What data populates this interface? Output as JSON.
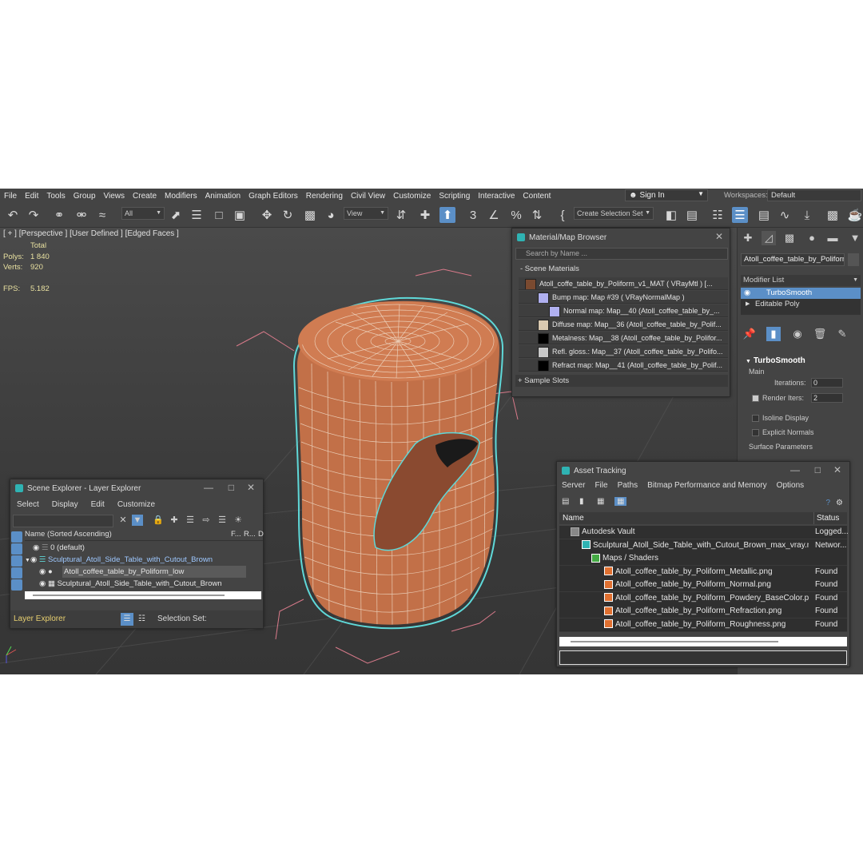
{
  "menu": [
    "File",
    "Edit",
    "Tools",
    "Group",
    "Views",
    "Create",
    "Modifiers",
    "Animation",
    "Graph Editors",
    "Rendering",
    "Civil View",
    "Customize",
    "Scripting",
    "Interactive",
    "Content"
  ],
  "signin": {
    "label": "Sign In"
  },
  "workspaces": {
    "label": "Workspaces:",
    "value": "Default"
  },
  "toolbar": {
    "filter": "All",
    "ref_coord": "View",
    "selection_set": "Create Selection Set"
  },
  "viewport": {
    "label": "[ + ] [Perspective ] [User Defined ] [Edged Faces ]",
    "stats_total": "Total",
    "polys_label": "Polys:",
    "polys": "1 840",
    "verts_label": "Verts:",
    "verts": "920",
    "fps_label": "FPS:",
    "fps": "5.182"
  },
  "material_browser": {
    "title": "Material/Map Browser",
    "search_placeholder": "Search by Name ...",
    "section": "- Scene Materials",
    "rows": [
      {
        "label": "Atoll_coffe_table_by_Poliform_v1_MAT  ( VRayMtl )  [...",
        "color": "#7a4a30"
      },
      {
        "label": "Bump map: Map #39  ( VRayNormalMap )",
        "color": "#b0b0f0"
      },
      {
        "label": "Normal map: Map__40 (Atoll_coffee_table_by_...",
        "color": "#b0b0f0"
      },
      {
        "label": "Diffuse map: Map__36 (Atoll_coffee_table_by_Polif...",
        "color": "#d8c8b0"
      },
      {
        "label": "Metalness: Map__38 (Atoll_coffee_table_by_Polifor...",
        "color": "#000000"
      },
      {
        "label": "Refl. gloss.: Map__37 (Atoll_coffee_table_by_Polifo...",
        "color": "#c8c8c8"
      },
      {
        "label": "Refract map: Map__41 (Atoll_coffee_table_by_Polif...",
        "color": "#000000"
      }
    ],
    "sample_slots": "+ Sample Slots"
  },
  "command_panel": {
    "object_name": "Atoll_coffee_table_by_Poliform",
    "modifier_list": "Modifier List",
    "stack": [
      "TurboSmooth",
      "Editable Poly"
    ],
    "rollout": "TurboSmooth",
    "main": "Main",
    "iterations_label": "Iterations:",
    "iterations": "0",
    "render_iters_label": "Render Iters:",
    "render_iters": "2",
    "isoline": "Isoline Display",
    "explicit": "Explicit Normals",
    "surface": "Surface Parameters"
  },
  "scene_explorer": {
    "title": "Scene Explorer - Layer Explorer",
    "menu": [
      "Select",
      "Display",
      "Edit",
      "Customize"
    ],
    "header": "Name (Sorted Ascending)",
    "col_f": "F...",
    "col_r": "R...",
    "col_d": "D",
    "rows": [
      "0 (default)",
      "Sculptural_Atoll_Side_Table_with_Cutout_Brown",
      "Atoll_coffee_table_by_Poliform_low",
      "Sculptural_Atoll_Side_Table_with_Cutout_Brown"
    ],
    "footer_left": "Layer Explorer",
    "footer_sel": "Selection Set:"
  },
  "asset_tracking": {
    "title": "Asset Tracking",
    "menu": [
      "Server",
      "File",
      "Paths",
      "Bitmap Performance and Memory",
      "Options"
    ],
    "col_name": "Name",
    "col_status": "Status",
    "rows": [
      {
        "name": "Autodesk Vault",
        "status": "Logged..."
      },
      {
        "name": "Sculptural_Atoll_Side_Table_with_Cutout_Brown_max_vray.max",
        "status": "Networ..."
      },
      {
        "name": "Maps / Shaders",
        "status": ""
      },
      {
        "name": "Atoll_coffee_table_by_Poliform_Metallic.png",
        "status": "Found"
      },
      {
        "name": "Atoll_coffee_table_by_Poliform_Normal.png",
        "status": "Found"
      },
      {
        "name": "Atoll_coffee_table_by_Poliform_Powdery_BaseColor.png",
        "status": "Found"
      },
      {
        "name": "Atoll_coffee_table_by_Poliform_Refraction.png",
        "status": "Found"
      },
      {
        "name": "Atoll_coffee_table_by_Poliform_Roughness.png",
        "status": "Found"
      }
    ]
  },
  "colors": {
    "accent": "#5b8fc7",
    "object": "#c27048",
    "wire": "#f0dcc8",
    "outline": "#5fd8d8"
  }
}
